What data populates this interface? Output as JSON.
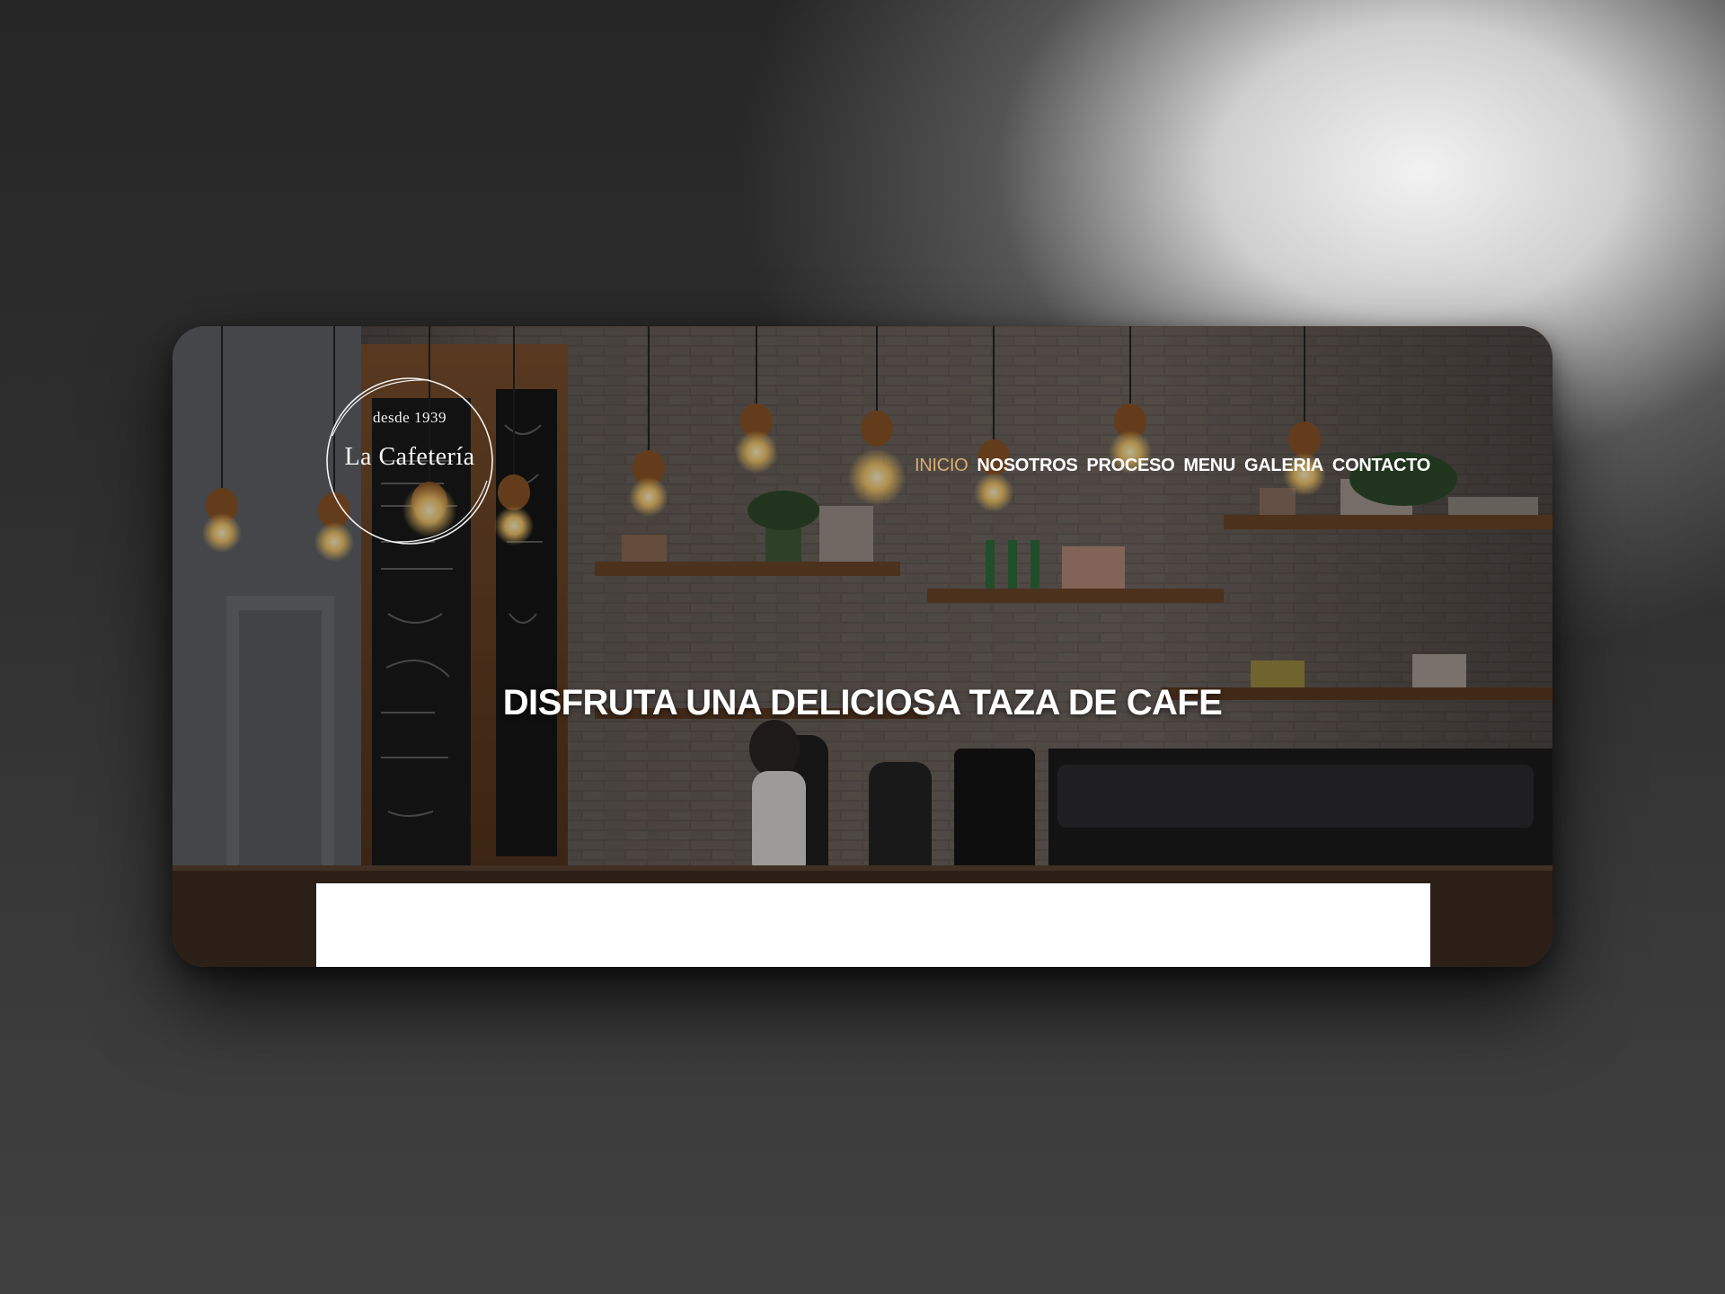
{
  "brand": {
    "since": "desde 1939",
    "name": "La Cafetería"
  },
  "nav": {
    "items": [
      "INICIO",
      "NOSOTROS",
      "PROCESO",
      "MENU",
      "GALERIA",
      "CONTACTO"
    ],
    "active": "INICIO",
    "active_color": "#d8ad72"
  },
  "hero": {
    "title": "DISFRUTA UNA DELICIOSA TAZA DE CAFE"
  }
}
